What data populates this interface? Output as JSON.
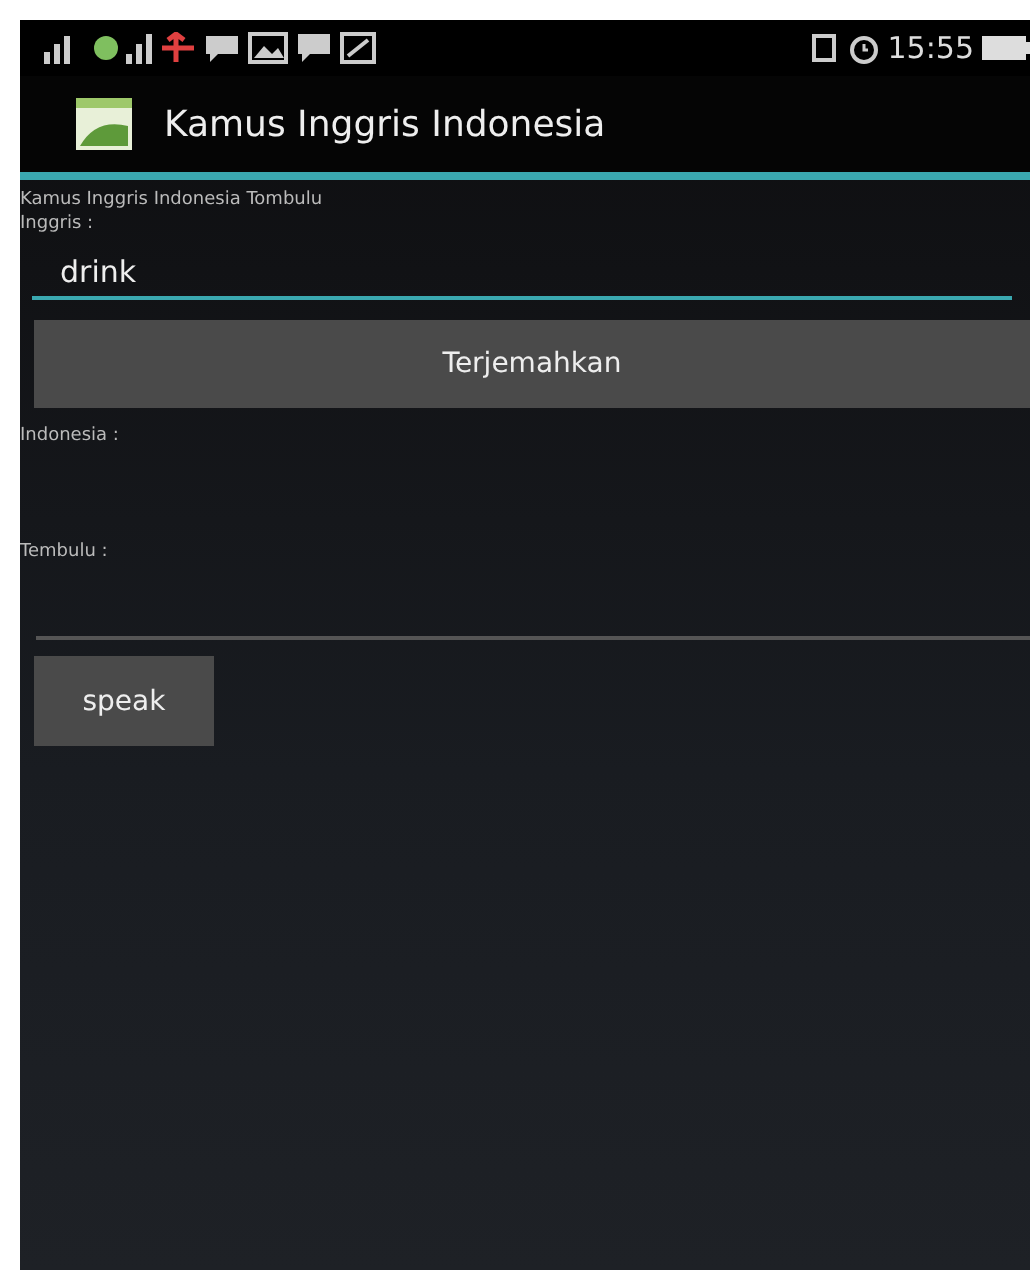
{
  "status_bar": {
    "time": "15:55"
  },
  "app_bar": {
    "title": "Kamus Inggris Indonesia"
  },
  "heading": "Kamus Inggris Indonesia Tombulu",
  "input": {
    "label": "Inggris :",
    "value": "drink"
  },
  "translate_button": "Terjemahkan",
  "results": [
    {
      "label": "Indonesia :"
    },
    {
      "label": "Tembulu :"
    }
  ],
  "speak_button": "speak"
}
